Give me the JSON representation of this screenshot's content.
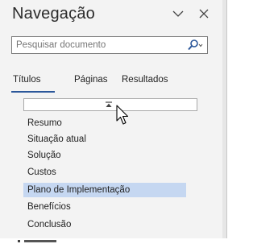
{
  "pane": {
    "title": "Navegação",
    "options_icon": "chevron-down-icon",
    "close_icon": "close-icon"
  },
  "search": {
    "placeholder": "Pesquisar documento",
    "icon": "search-icon"
  },
  "tabs": [
    {
      "label": "Títulos",
      "active": true
    },
    {
      "label": "Páginas",
      "active": false
    },
    {
      "label": "Resultados",
      "active": false
    }
  ],
  "headings": [
    {
      "label": "Resumo",
      "selected": false
    },
    {
      "label": "Situação atual",
      "selected": false
    },
    {
      "label": "Solução",
      "selected": false
    },
    {
      "label": "Custos",
      "selected": false
    },
    {
      "label": "Plano de Implementação",
      "selected": true
    },
    {
      "label": "Benefícios",
      "selected": false
    },
    {
      "label": "Conclusão",
      "selected": false
    }
  ],
  "colors": {
    "accent": "#2b579a",
    "selection": "#c5d7f1",
    "pane_bg": "#f3f3f3"
  }
}
